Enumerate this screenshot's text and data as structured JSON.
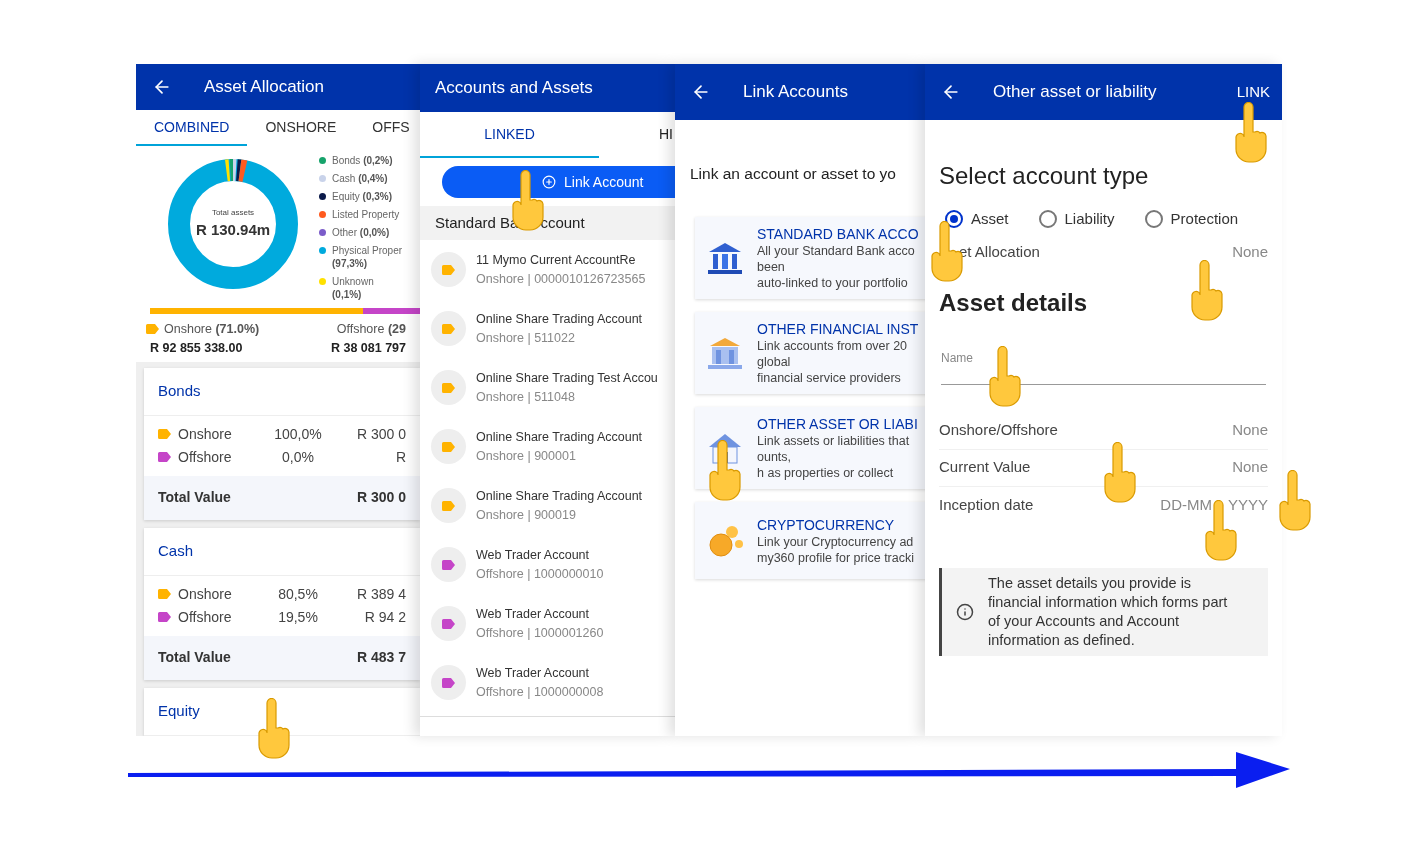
{
  "asset_allocation": {
    "title": "Asset Allocation",
    "tabs": [
      {
        "label": "COMBINED",
        "selected": true
      },
      {
        "label": "ONSHORE",
        "selected": false
      },
      {
        "label": "OFFS",
        "selected": false
      }
    ],
    "donut": {
      "caption": "Total assets",
      "total": "R 130.94m"
    },
    "legend": [
      {
        "label": "Bonds",
        "value": "(0,2%)",
        "color": "#16a36b"
      },
      {
        "label": "Cash",
        "value": "(0,4%)",
        "color": "#c9d3ea"
      },
      {
        "label": "Equity",
        "value": "(0,3%)",
        "color": "#0b1a4a"
      },
      {
        "label": "Listed Property",
        "color": "#ff5a1f"
      },
      {
        "label": "Other",
        "value": "(0,0%)",
        "color": "#7b5cc9"
      },
      {
        "label": "Physical Proper",
        "value": "(97,3%)",
        "color": "#00aadd"
      },
      {
        "label": "Unknown",
        "value": "(0,1%)",
        "color": "#ffe100"
      }
    ],
    "split": {
      "level": 0.71,
      "onshore_label": "Onshore",
      "onshore_pct": "(71.0%)",
      "onshore_value": "R 92 855 338.00",
      "offshore_label": "Offshore",
      "offshore_pct": "(29",
      "offshore_value": "R 38 081 797"
    },
    "cards": [
      {
        "title": "Bonds",
        "rows": [
          {
            "region": "Onshore",
            "color": "#ffb300",
            "pct": "100,0%",
            "value": "R 300 0"
          },
          {
            "region": "Offshore",
            "color": "#c545c8",
            "pct": "0,0%",
            "value": "R"
          }
        ],
        "total_label": "Total Value",
        "total": "R 300 0"
      },
      {
        "title": "Cash",
        "rows": [
          {
            "region": "Onshore",
            "color": "#ffb300",
            "pct": "80,5%",
            "value": "R 389 4"
          },
          {
            "region": "Offshore",
            "color": "#c545c8",
            "pct": "19,5%",
            "value": "R 94 2"
          }
        ],
        "total_label": "Total Value",
        "total": "R 483 7"
      },
      {
        "title": "Equity"
      }
    ]
  },
  "accounts_and_assets": {
    "title": "Accounts and Assets",
    "tabs": [
      {
        "label": "LINKED",
        "selected": true
      },
      {
        "label": "HI",
        "selected": false
      }
    ],
    "link_button": "Link Account",
    "section_before": "Standard Ba",
    "section_after": "ccount",
    "accounts": [
      {
        "name": "11 Mymo Current AccountRe",
        "detail": "Onshore | 0000010126723565",
        "color": "#ffb300"
      },
      {
        "name": "Online Share Trading Account",
        "detail": "Onshore | 511022",
        "color": "#ffb300"
      },
      {
        "name": "Online Share Trading Test Accou",
        "detail": "Onshore | 511048",
        "color": "#ffb300"
      },
      {
        "name": "Online Share Trading Account",
        "detail": "Onshore | 900001",
        "color": "#ffb300"
      },
      {
        "name": "Online Share Trading Account",
        "detail": "Onshore | 900019",
        "color": "#ffb300"
      },
      {
        "name": "Web Trader Account",
        "detail": "Offshore | 1000000010",
        "color": "#c545c8"
      },
      {
        "name": "Web Trader Account",
        "detail": "Offshore | 1000001260",
        "color": "#c545c8"
      },
      {
        "name": "Web Trader Account",
        "detail": "Offshore | 1000000008",
        "color": "#c545c8"
      }
    ]
  },
  "link_accounts": {
    "title": "Link Accounts",
    "intro": "Link an account or asset to yo",
    "options": [
      {
        "title": "STANDARD BANK ACCO",
        "lines": [
          "All your Standard Bank acco",
          "been",
          "auto-linked to your portfolio"
        ]
      },
      {
        "title": "OTHER FINANCIAL INST",
        "lines": [
          "Link accounts from over 20",
          "global",
          "financial service providers"
        ]
      },
      {
        "title": "OTHER ASSET OR LIABI",
        "lines": [
          "Link assets or liabilities that",
          "ounts,",
          "h as properties or collect"
        ]
      },
      {
        "title": "CRYPTOCURRENCY",
        "lines": [
          "Link your Cryptocurrency ad",
          "my360 profile for price tracki"
        ]
      }
    ]
  },
  "other_asset": {
    "title": "Other asset or liability",
    "action": "LINK",
    "heading": "Select account type",
    "types": [
      {
        "label": "Asset",
        "selected": true
      },
      {
        "label": "Liability",
        "selected": false
      },
      {
        "label": "Protection",
        "selected": false
      }
    ],
    "allocation_label": "et Allocation",
    "allocation_value": "None",
    "details_heading": "Asset details",
    "name_label": "Name",
    "fields": [
      {
        "label": "Onshore/Offshore",
        "value": "None"
      },
      {
        "label": "Current Value",
        "value": "None"
      }
    ],
    "date_label": "Inception date",
    "date_before": "DD-MM",
    "date_after": "YYYY",
    "notice": "The asset details you provide is financial information which forms part of your Accounts and Account information as defined."
  }
}
